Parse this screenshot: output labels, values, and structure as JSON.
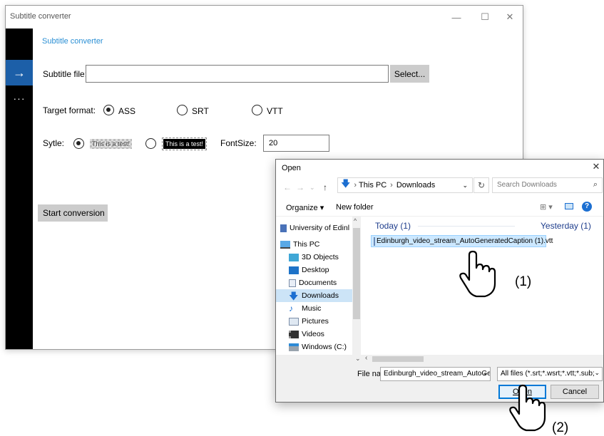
{
  "app": {
    "window_title": "Subtitle converter",
    "header_link": "Subtitle converter",
    "nav": {
      "arrow_icon": "arrow-right-icon",
      "more": "···"
    },
    "subtitle_file": {
      "label": "Subtitle file:",
      "value": "",
      "select_button": "Select..."
    },
    "target_format": {
      "label": "Target format:",
      "options": [
        {
          "label": "ASS",
          "checked": true
        },
        {
          "label": "SRT",
          "checked": false
        },
        {
          "label": "VTT",
          "checked": false
        }
      ]
    },
    "style": {
      "label": "Sytle:",
      "sample_light": "This is a test!",
      "sample_dark": "This is a test!",
      "selected": "light",
      "fontsize_label": "FontSize:",
      "fontsize_value": "20"
    },
    "start_button": "Start conversion",
    "window_controls": {
      "minimize": "—",
      "maximize": "☐",
      "close": "✕"
    },
    "accent_color": "#1c5fa8",
    "link_color": "#2a8fd4"
  },
  "dialog": {
    "title": "Open",
    "close": "✕",
    "address": {
      "segments": [
        "This PC",
        "Downloads"
      ]
    },
    "search_placeholder": "Search Downloads",
    "toolbar": {
      "organize": "Organize ▾",
      "new_folder": "New folder",
      "help": "?"
    },
    "nav_tree": [
      {
        "label": "University of Edinl",
        "icon": "building-icon",
        "selected": false
      },
      {
        "label": "This PC",
        "icon": "computer-icon",
        "selected": false
      },
      {
        "label": "3D Objects",
        "icon": "cube-icon",
        "selected": false
      },
      {
        "label": "Desktop",
        "icon": "desktop-icon",
        "selected": false
      },
      {
        "label": "Documents",
        "icon": "document-icon",
        "selected": false
      },
      {
        "label": "Downloads",
        "icon": "download-arrow-icon",
        "selected": true
      },
      {
        "label": "Music",
        "icon": "music-note-icon",
        "selected": false
      },
      {
        "label": "Pictures",
        "icon": "picture-icon",
        "selected": false
      },
      {
        "label": "Videos",
        "icon": "video-icon",
        "selected": false
      },
      {
        "label": "Windows (C:)",
        "icon": "drive-icon",
        "selected": false
      }
    ],
    "groups": [
      {
        "header": "Today (1)",
        "files": [
          "Edinburgh_video_stream_AutoGeneratedCaption (1).vtt"
        ]
      },
      {
        "header": "Yesterday (1)",
        "files": []
      }
    ],
    "file_name": {
      "label": "File name:",
      "value": "Edinburgh_video_stream_AutoGer"
    },
    "file_type": "All files (*.srt;*.wsrt;*.vtt;*.sub;*.",
    "open_button": "Open",
    "cancel_button": "Cancel"
  },
  "annotations": {
    "step1": "(1)",
    "step2": "(2)"
  }
}
